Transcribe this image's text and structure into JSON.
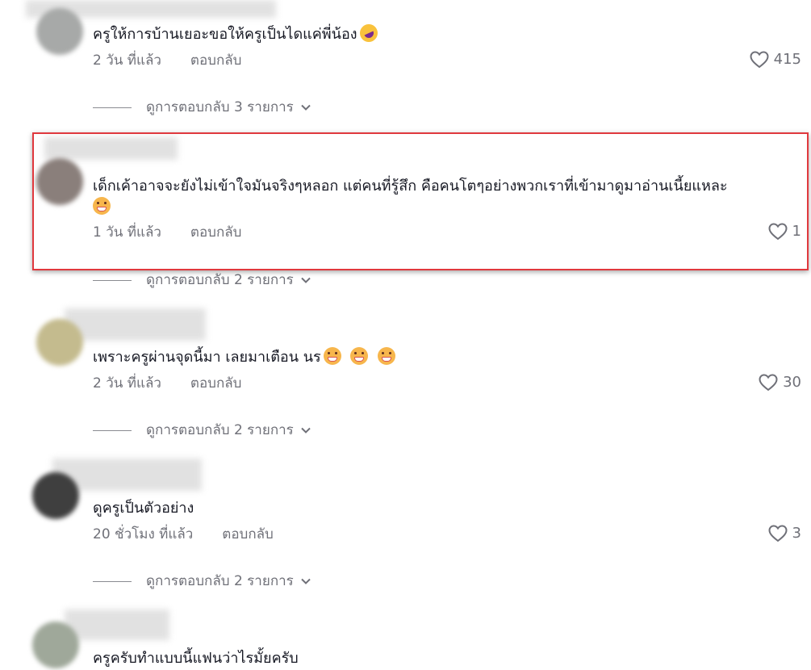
{
  "comments": [
    {
      "text": "ครูให้การบ้านเยอะขอให้ครูเป็นไดแค่พี่น้อง",
      "emoji": "rofl-icon",
      "time": "2 วัน ที่แล้ว",
      "reply_label": "ตอบกลับ",
      "likes": "415",
      "view_replies": "ดูการตอบกลับ 3 รายการ"
    },
    {
      "text": "เด็กเค้าอาจจะยังไม่เข้าใจมันจริงๆหลอก แต่คนที่รู้สึก คือคนโตๆอย่างพวกเราที่เข้ามาดูมาอ่านเนี้ยแหละ",
      "emoji": "grin-icon",
      "time": "1 วัน ที่แล้ว",
      "reply_label": "ตอบกลับ",
      "likes": "1",
      "view_replies": "ดูการตอบกลับ 2 รายการ",
      "highlighted": true
    },
    {
      "text": "เพราะครูผ่านจุดนี้มา เลยมาเตือน นร",
      "emoji": "grin-icon",
      "emoji_count": 3,
      "time": "2 วัน ที่แล้ว",
      "reply_label": "ตอบกลับ",
      "likes": "30",
      "view_replies": "ดูการตอบกลับ 2 รายการ"
    },
    {
      "text": "ดูครูเป็นตัวอย่าง",
      "time": "20 ชั่วโมง ที่แล้ว",
      "reply_label": "ตอบกลับ",
      "likes": "3",
      "view_replies": "ดูการตอบกลับ 2 รายการ"
    },
    {
      "text": "ครูครับทำแบบนี้แฟนว่าไรมั้ยครับ"
    }
  ],
  "colors": {
    "highlight_border": "#e0393e",
    "text_primary": "#161823",
    "text_secondary": "#6f7078"
  }
}
